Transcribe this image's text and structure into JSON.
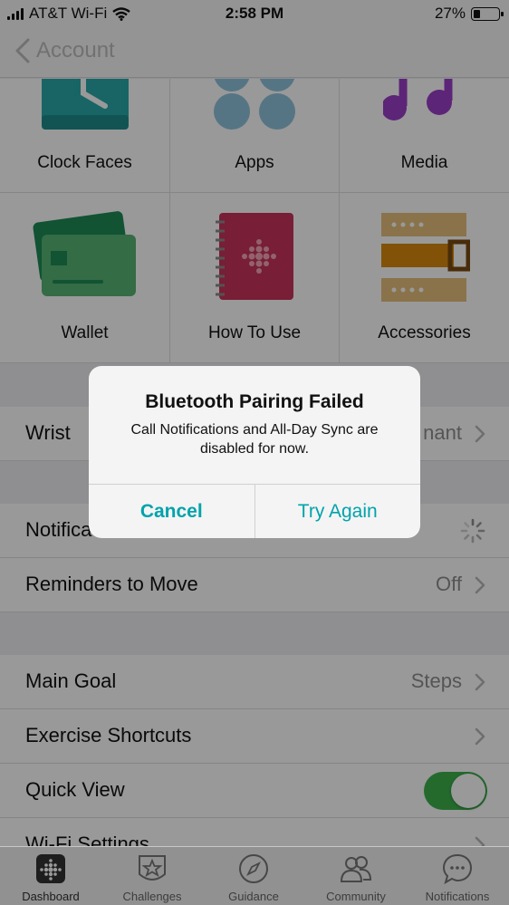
{
  "status_bar": {
    "carrier": "AT&T Wi-Fi",
    "time": "2:58 PM",
    "battery": "27%",
    "battery_level": 0.27
  },
  "nav": {
    "back_label": "Account"
  },
  "grid": {
    "items": [
      {
        "label": "Clock Faces",
        "icon": "clock-faces-icon"
      },
      {
        "label": "Apps",
        "icon": "apps-icon"
      },
      {
        "label": "Media",
        "icon": "music-note-icon"
      },
      {
        "label": "Wallet",
        "icon": "wallet-cards-icon"
      },
      {
        "label": "How To Use",
        "icon": "fitbit-notebook-icon"
      },
      {
        "label": "Accessories",
        "icon": "watch-band-icon"
      }
    ]
  },
  "settings": {
    "wrist": {
      "label": "Wrist",
      "value": "nant"
    },
    "notifications": {
      "label": "Notifica"
    },
    "reminders": {
      "label": "Reminders to Move",
      "value": "Off"
    },
    "main_goal": {
      "label": "Main Goal",
      "value": "Steps"
    },
    "exercise_shortcuts": {
      "label": "Exercise Shortcuts"
    },
    "quick_view": {
      "label": "Quick View",
      "enabled": true
    },
    "wifi": {
      "label": "Wi-Fi Settings"
    }
  },
  "alert": {
    "title": "Bluetooth Pairing Failed",
    "message": "Call Notifications and All-Day Sync are disabled for now.",
    "cancel_label": "Cancel",
    "retry_label": "Try Again"
  },
  "tabs": [
    {
      "label": "Dashboard",
      "icon": "dashboard-icon"
    },
    {
      "label": "Challenges",
      "icon": "challenges-star-icon"
    },
    {
      "label": "Guidance",
      "icon": "compass-icon"
    },
    {
      "label": "Community",
      "icon": "community-people-icon"
    },
    {
      "label": "Notifications",
      "icon": "chat-bubble-icon"
    }
  ],
  "colors": {
    "accent": "#00a3ad",
    "toggle_on": "#3cb14c"
  }
}
